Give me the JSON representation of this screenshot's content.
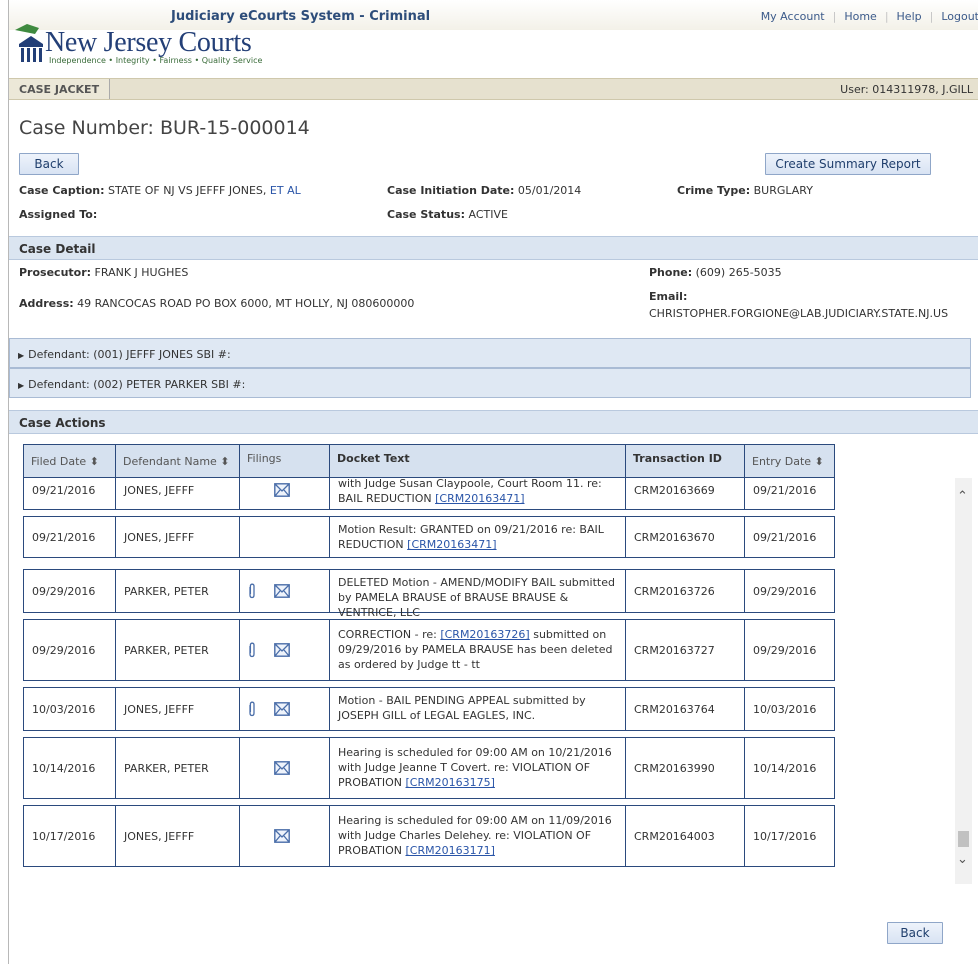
{
  "header": {
    "system_title": "Judiciary eCourts System - Criminal",
    "links": [
      "My Account",
      "Home",
      "Help",
      "Logout"
    ],
    "logo_text": "New Jersey Courts",
    "logo_tagline": "Independence • Integrity • Fairness • Quality Service"
  },
  "subbar": {
    "tab": "CASE JACKET",
    "user": "User: 014311978, J.GILL"
  },
  "case": {
    "number": "Case Number: BUR-15-000014",
    "back_label": "Back",
    "summary_label": "Create Summary Report",
    "caption_label": "Case Caption:",
    "caption_value": "STATE OF NJ VS JEFFF JONES,",
    "caption_link": "ET AL",
    "initiation_label": "Case Initiation Date:",
    "initiation_value": "05/01/2014",
    "crime_label": "Crime Type:",
    "crime_value": "BURGLARY",
    "assigned_label": "Assigned To:",
    "status_label": "Case Status:",
    "status_value": "ACTIVE"
  },
  "detail": {
    "title": "Case Detail",
    "prosecutor_label": "Prosecutor:",
    "prosecutor_value": "FRANK J HUGHES",
    "phone_label": "Phone:",
    "phone_value": "(609) 265-5035",
    "address_label": "Address:",
    "address_value": "49 RANCOCAS ROAD PO BOX 6000, MT HOLLY, NJ 080600000",
    "email_label": "Email:",
    "email_value": "CHRISTOPHER.FORGIONE@LAB.JUDICIARY.STATE.NJ.US"
  },
  "defendants": [
    "Defendant: (001) JEFFF JONES    SBI #:",
    "Defendant: (002) PETER PARKER    SBI #:"
  ],
  "actions": {
    "title": "Case Actions",
    "columns": [
      "Filed Date ⬍",
      "Defendant Name ⬍",
      "Filings",
      "Docket Text",
      "Transaction ID",
      "Entry Date ⬍"
    ],
    "rows": [
      {
        "filed": "09/21/2016",
        "defendant": "JONES, JEFFF",
        "clip": false,
        "env": true,
        "docket": "with Judge Susan Claypoole, Court Room 11. re: BAIL REDUCTION",
        "link": "[CRM20163471]",
        "txn": "CRM20163669",
        "entry": "09/21/2016"
      },
      {
        "filed": "09/21/2016",
        "defendant": "JONES, JEFFF",
        "clip": false,
        "env": false,
        "docket": "Motion Result: GRANTED on 09/21/2016 re: BAIL REDUCTION",
        "link": "[CRM20163471]",
        "txn": "CRM20163670",
        "entry": "09/21/2016"
      },
      {
        "filed": "09/29/2016",
        "defendant": "PARKER, PETER",
        "clip": true,
        "env": true,
        "docket": "DELETED Motion - AMEND/MODIFY BAIL submitted by PAMELA BRAUSE of BRAUSE BRAUSE & VENTRICE, LLC",
        "link": "",
        "txn": "CRM20163726",
        "entry": "09/29/2016"
      },
      {
        "filed": "09/29/2016",
        "defendant": "PARKER, PETER",
        "clip": true,
        "env": true,
        "docket_pre": "CORRECTION - re:",
        "link": "[CRM20163726]",
        "docket": "submitted on 09/29/2016 by PAMELA BRAUSE has been deleted as ordered by Judge tt - tt",
        "txn": "CRM20163727",
        "entry": "09/29/2016"
      },
      {
        "filed": "10/03/2016",
        "defendant": "JONES, JEFFF",
        "clip": true,
        "env": true,
        "docket": "Motion - BAIL PENDING APPEAL submitted by JOSEPH GILL of LEGAL EAGLES, INC.",
        "link": "",
        "txn": "CRM20163764",
        "entry": "10/03/2016"
      },
      {
        "filed": "10/14/2016",
        "defendant": "PARKER, PETER",
        "clip": false,
        "env": true,
        "docket": "Hearing is scheduled for 09:00 AM on 10/21/2016 with Judge Jeanne T Covert. re: VIOLATION OF PROBATION",
        "link": "[CRM20163175]",
        "txn": "CRM20163990",
        "entry": "10/14/2016"
      },
      {
        "filed": "10/17/2016",
        "defendant": "JONES, JEFFF",
        "clip": false,
        "env": true,
        "docket": "Hearing is scheduled for 09:00 AM on 11/09/2016 with Judge Charles Delehey. re: VIOLATION OF PROBATION",
        "link": "[CRM20163171]",
        "txn": "CRM20164003",
        "entry": "10/17/2016"
      }
    ],
    "back_label": "Back"
  }
}
